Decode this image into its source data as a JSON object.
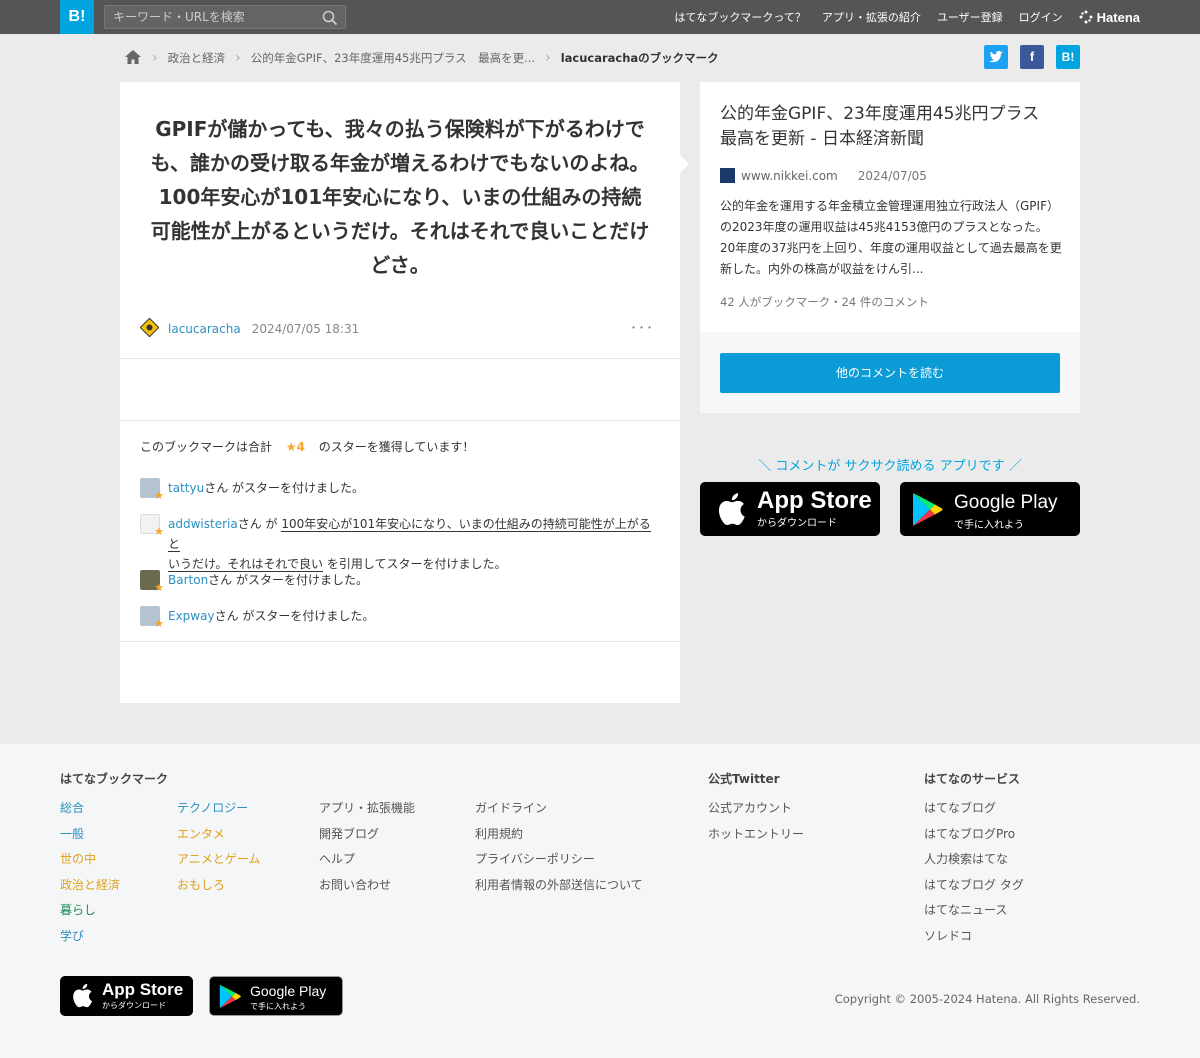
{
  "header": {
    "logo": "B!",
    "search_placeholder": "キーワード・URLを検索",
    "nav": [
      "はてなブックマークって？",
      "アプリ・拡張の紹介",
      "ユーザー登録",
      "ログイン"
    ],
    "brand": "Hatena"
  },
  "breadcrumb": {
    "items": [
      "政治と経済",
      "公的年金GPIF、23年度運用45兆円プラス　最高を更..."
    ],
    "current": "lacucarachaのブックマーク"
  },
  "share": {
    "twitter": "t",
    "facebook": "f",
    "hatena": "B!"
  },
  "bookmark": {
    "comment": "GPIFが儲かっても、我々の払う保険料が下がるわけでも、誰かの受け取る年金が増えるわけでもないのよね。100年安心が101年安心になり、いまの仕組みの持続可能性が上がるというだけ。それはそれで良いことだけどさ。",
    "user": "lacucaracha",
    "date": "2024/07/05 18:31",
    "more": "･･･"
  },
  "stars": {
    "pre": "このブックマークは合計",
    "count": "★4",
    "post": "のスターを獲得しています！",
    "suffix_san": "さん",
    "rows": [
      {
        "user": "tattyu",
        "text": " がスターを付けました。"
      },
      {
        "user": "addwisteria",
        "text1": " が ",
        "quote1": "100年安心が101年安心になり、いまの仕組みの持続可能性が上がると",
        "quote2": "いうだけ。それはそれで良い",
        "text2": " を引用してスターを付けました。"
      },
      {
        "user": "Barton",
        "text": " がスターを付けました。"
      },
      {
        "user": "Expway",
        "text": " がスターを付けました。"
      }
    ]
  },
  "entry": {
    "title": "公的年金GPIF、23年度運用45兆円プラス　最高を更新 - 日本経済新聞",
    "domain": "www.nikkei.com",
    "date": "2024/07/05",
    "summary": "公的年金を運用する年金積立金管理運用独立行政法人（GPIF）の2023年度の運用収益は45兆4153億円のプラスとなった。20年度の37兆円を上回り、年度の運用収益として過去最高を更新した。内外の株高が収益をけん引...",
    "counts": "42 人がブックマーク・24 件のコメント",
    "read_button": "他のコメントを読む"
  },
  "app": {
    "note": "＼ コメントが サクサク読める アプリです ／",
    "appstore_main": "App Store",
    "appstore_sub": "からダウンロード",
    "googleplay_main": "Google Play",
    "googleplay_sub": "で手に入れよう"
  },
  "footer": {
    "h1": "はてなブックマーク",
    "col1": [
      "総合",
      "一般",
      "世の中",
      "政治と経済",
      "暮らし",
      "学び"
    ],
    "col2": [
      "テクノロジー",
      "エンタメ",
      "アニメとゲーム",
      "おもしろ"
    ],
    "col3": [
      "アプリ・拡張機能",
      "開発ブログ",
      "ヘルプ",
      "お問い合わせ"
    ],
    "col4": [
      "ガイドライン",
      "利用規約",
      "プライバシーポリシー",
      "利用者情報の外部送信について"
    ],
    "h2": "公式Twitter",
    "col5": [
      "公式アカウント",
      "ホットエントリー"
    ],
    "h3": "はてなのサービス",
    "col6": [
      "はてなブログ",
      "はてなブログPro",
      "人力検索はてな",
      "はてなブログ タグ",
      "はてなニュース",
      "ソレドコ"
    ],
    "copyright": "Copyright © 2005-2024 Hatena. All Rights Reserved."
  }
}
